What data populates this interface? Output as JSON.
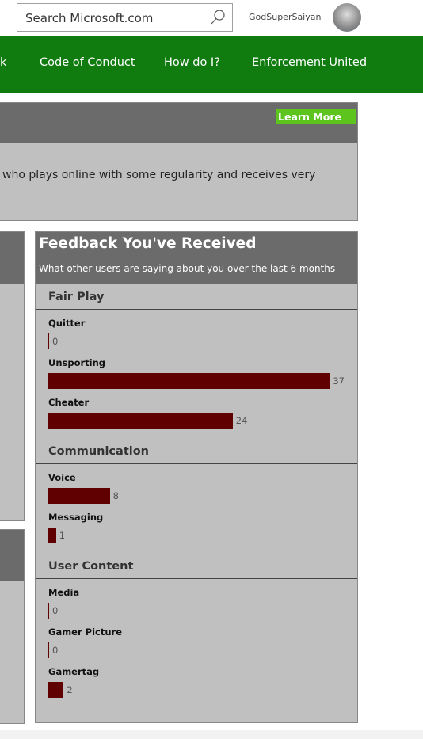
{
  "header": {
    "search_placeholder": "Search Microsoft.com",
    "username": "GodSuperSaiyan"
  },
  "nav": [
    "k",
    "Code of Conduct",
    "How do I?",
    "Enforcement United"
  ],
  "intro": {
    "learn_more": "Learn More",
    "text": "who plays online with some regularity and receives very"
  },
  "feedback": {
    "title": "Feedback You've Received",
    "subtitle": "What other users are saying about you over the last 6 months",
    "bar_color": "#600000",
    "sections": [
      {
        "name": "Fair Play",
        "items": [
          {
            "label": "Quitter",
            "value": 0
          },
          {
            "label": "Unsporting",
            "value": 37
          },
          {
            "label": "Cheater",
            "value": 24
          }
        ]
      },
      {
        "name": "Communication",
        "items": [
          {
            "label": "Voice",
            "value": 8
          },
          {
            "label": "Messaging",
            "value": 1
          }
        ]
      },
      {
        "name": "User Content",
        "items": [
          {
            "label": "Media",
            "value": 0
          },
          {
            "label": "Gamer Picture",
            "value": 0
          },
          {
            "label": "Gamertag",
            "value": 2
          }
        ]
      }
    ]
  }
}
